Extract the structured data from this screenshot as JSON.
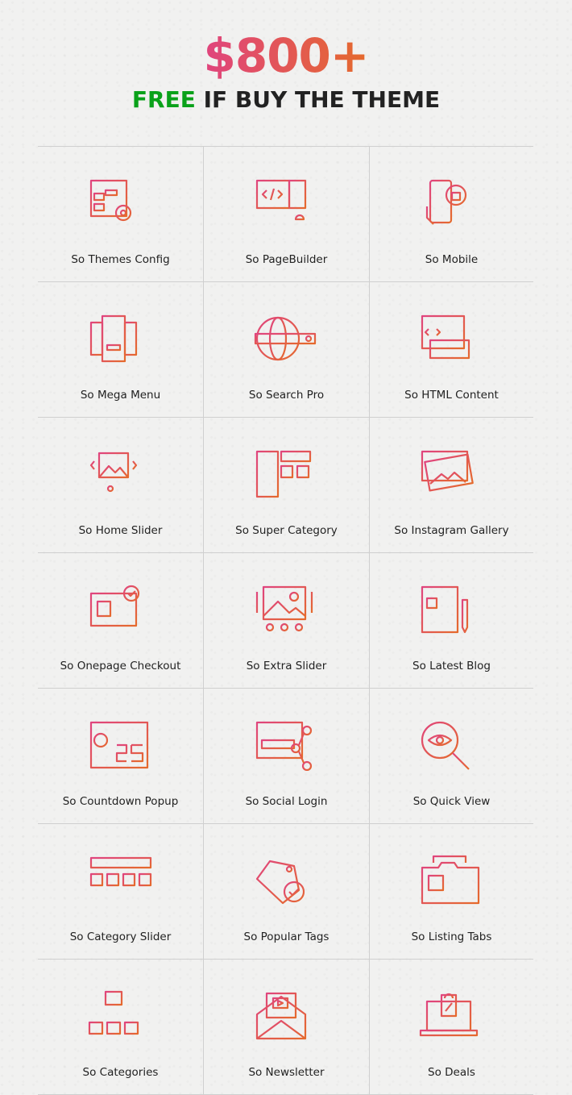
{
  "header": {
    "price": "$800+",
    "free": "FREE",
    "subtitle": "IF BUY THE THEME"
  },
  "colors": {
    "gradient_start": "#e0447e",
    "gradient_end": "#e56a2c",
    "free": "#0aa11a"
  },
  "modules": [
    {
      "label": "So Themes Config",
      "icon": "config-window-icon"
    },
    {
      "label": "So PageBuilder",
      "icon": "monitor-code-icon"
    },
    {
      "label": "So Mobile",
      "icon": "mobile-shop-icon"
    },
    {
      "label": "So Mega Menu",
      "icon": "menu-panels-icon"
    },
    {
      "label": "So Search Pro",
      "icon": "globe-search-icon"
    },
    {
      "label": "So HTML Content",
      "icon": "html-window-icon"
    },
    {
      "label": "So Home Slider",
      "icon": "image-slider-icon"
    },
    {
      "label": "So Super Category",
      "icon": "category-layout-icon"
    },
    {
      "label": "So Instagram Gallery",
      "icon": "photo-stack-icon"
    },
    {
      "label": "So Onepage Checkout",
      "icon": "monitor-checkout-icon"
    },
    {
      "label": "So Extra Slider",
      "icon": "extra-slider-icon"
    },
    {
      "label": "So Latest Blog",
      "icon": "blog-page-icon"
    },
    {
      "label": "So Countdown Popup",
      "icon": "countdown-calendar-icon"
    },
    {
      "label": "So Social Login",
      "icon": "social-login-icon"
    },
    {
      "label": "So Quick View",
      "icon": "magnifier-eye-icon"
    },
    {
      "label": "So Category Slider",
      "icon": "category-grid-icon"
    },
    {
      "label": "So Popular Tags",
      "icon": "tags-icon"
    },
    {
      "label": "So Listing Tabs",
      "icon": "folder-tabs-icon"
    },
    {
      "label": "So Categories",
      "icon": "sitemap-icon"
    },
    {
      "label": "So Newsletter",
      "icon": "envelope-video-icon"
    },
    {
      "label": "So Deals",
      "icon": "laptop-deal-icon"
    }
  ]
}
